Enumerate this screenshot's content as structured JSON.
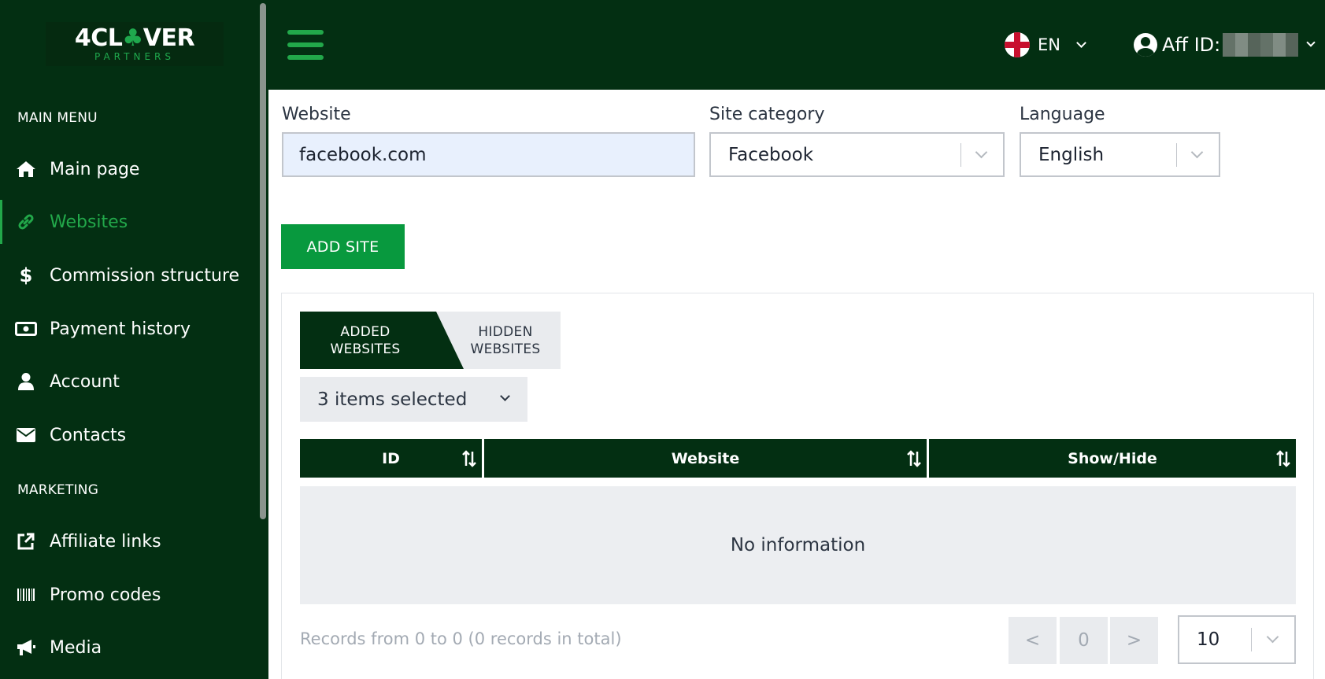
{
  "brand": {
    "logo_pre": "4CL",
    "logo_clover": "♣",
    "logo_post": "VER",
    "logo_sub": "PARTNERS"
  },
  "sidebar": {
    "main_menu_title": "MAIN MENU",
    "marketing_title": "MARKETING",
    "items": [
      {
        "label": "Main page",
        "icon": "home-icon"
      },
      {
        "label": "Websites",
        "icon": "link-icon",
        "active": true
      },
      {
        "label": "Commission structure",
        "icon": "dollar-icon"
      },
      {
        "label": "Payment history",
        "icon": "banknote-icon"
      },
      {
        "label": "Account",
        "icon": "user-icon"
      },
      {
        "label": "Contacts",
        "icon": "envelope-icon"
      },
      {
        "label": "Affiliate links",
        "icon": "external-link-icon"
      },
      {
        "label": "Promo codes",
        "icon": "barcode-icon"
      },
      {
        "label": "Media",
        "icon": "megaphone-icon"
      }
    ]
  },
  "header": {
    "language": "EN",
    "aff_label": "Aff ID:"
  },
  "form": {
    "website_label": "Website",
    "website_value": "facebook.com",
    "category_label": "Site category",
    "category_value": "Facebook",
    "language_label": "Language",
    "language_value": "English",
    "add_button": "ADD SITE"
  },
  "tabs": {
    "added_line1": "ADDED",
    "added_line2": "WEBSITES",
    "hidden_line1": "HIDDEN",
    "hidden_line2": "WEBSITES"
  },
  "filter": {
    "selected_text": "3 items selected"
  },
  "table": {
    "columns": [
      "ID",
      "Website",
      "Show/Hide"
    ],
    "empty_text": "No information"
  },
  "pagination": {
    "records_text": "Records from 0 to 0 (0 records in total)",
    "prev": "<",
    "current": "0",
    "next": ">",
    "page_size": "10"
  },
  "colors": {
    "dark_green": "#032f12",
    "accent_green": "#22a84a",
    "button_green": "#08993e"
  }
}
